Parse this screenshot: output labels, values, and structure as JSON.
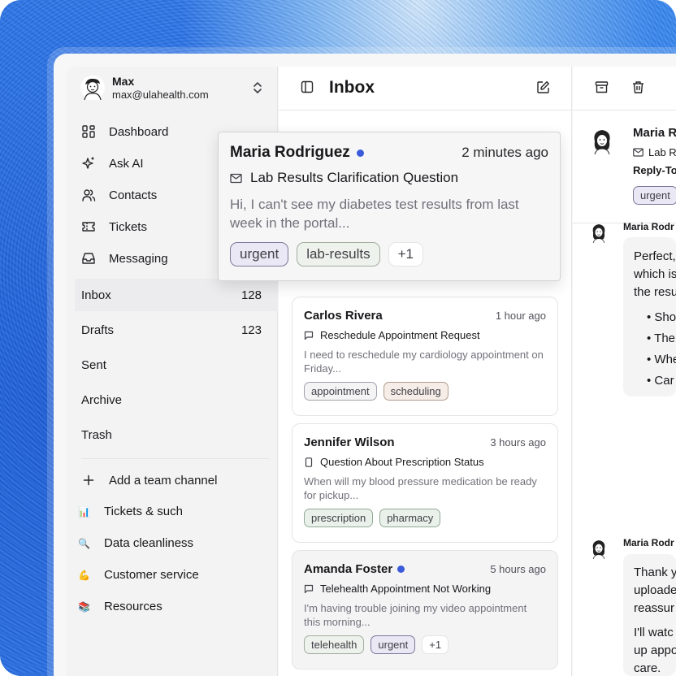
{
  "user": {
    "name": "Max",
    "email": "max@ulahealth.com"
  },
  "nav": [
    {
      "label": "Dashboard",
      "icon": "grid-icon"
    },
    {
      "label": "Ask AI",
      "icon": "sparkle-icon"
    },
    {
      "label": "Contacts",
      "icon": "users-icon"
    },
    {
      "label": "Tickets",
      "icon": "ticket-icon"
    },
    {
      "label": "Messaging",
      "icon": "inbox-tray-icon"
    }
  ],
  "folders": [
    {
      "label": "Inbox",
      "count": "128"
    },
    {
      "label": "Drafts",
      "count": "123"
    },
    {
      "label": "Sent",
      "count": ""
    },
    {
      "label": "Archive",
      "count": ""
    },
    {
      "label": "Trash",
      "count": ""
    }
  ],
  "add_channel": "Add a team channel",
  "channels": [
    {
      "label": "Tickets & such",
      "emoji": "📊"
    },
    {
      "label": "Data cleanliness",
      "emoji": "🔍"
    },
    {
      "label": "Customer service",
      "emoji": "💪"
    },
    {
      "label": "Resources",
      "emoji": "📚"
    }
  ],
  "list": {
    "title": "Inbox",
    "messages": [
      {
        "name": "Carlos Rivera",
        "time": "1 hour ago",
        "subject": "Reschedule Appointment Request",
        "preview_line1": "I need to reschedule my cardiology appointment on",
        "preview_line2": "Friday...",
        "tags": [
          "appointment",
          "scheduling"
        ]
      },
      {
        "name": "Jennifer Wilson",
        "time": "3 hours ago",
        "subject": "Question About Prescription Status",
        "preview_line1": "When will my blood pressure medication be ready",
        "preview_line2": "for pickup...",
        "tags": [
          "prescription",
          "pharmacy"
        ]
      },
      {
        "name": "Amanda Foster",
        "time": "5 hours ago",
        "subject": "Telehealth Appointment Not Working",
        "preview_line1": "I'm having trouble joining my video appointment",
        "preview_line2": "this morning...",
        "tags": [
          "telehealth",
          "urgent"
        ],
        "more": "+1"
      }
    ]
  },
  "popup": {
    "name": "Maria Rodriguez",
    "time": "2 minutes ago",
    "subject": "Lab Results Clarification Question",
    "preview_line1": "Hi, I can't see my diabetes test results from last",
    "preview_line2": "week in the portal...",
    "tags": [
      "urgent",
      "lab-results"
    ],
    "more": "+1"
  },
  "detail": {
    "header_name": "Maria R",
    "header_subject": "Lab R",
    "reply_to": "Reply-To",
    "header_tag": "urgent",
    "msg1_name": "Maria Rodr",
    "msg1_lines": [
      "Perfect,",
      "which is",
      "the resu"
    ],
    "msg1_bullets": [
      "Sho",
      "The",
      "Whe",
      "Car"
    ],
    "msg2_name": "Maria Rodr",
    "msg2_lines": [
      "Thank y",
      "uploade",
      "reassur"
    ],
    "msg2_lines2": [
      "I'll watc",
      "up appo",
      "care."
    ]
  },
  "colors": {
    "accent_dot": "#3b5bdb",
    "background_blue": "#2a72e6"
  }
}
